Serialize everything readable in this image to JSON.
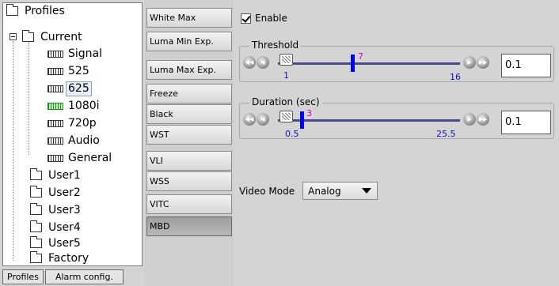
{
  "tree": {
    "root": "Profiles",
    "current": "Current",
    "current_children": [
      "Signal",
      "525",
      "625",
      "1080i",
      "720p",
      "Audio",
      "General"
    ],
    "users": [
      "User1",
      "User2",
      "User3",
      "User4",
      "User5"
    ],
    "factory": "Factory",
    "selected": "625"
  },
  "bottom_tabs": [
    "Profiles",
    "Alarm config."
  ],
  "categories": [
    "White Max",
    "Luma Min Exp.",
    "Luma Max Exp.",
    "Freeze",
    "Black",
    "WST",
    "VLI",
    "WSS",
    "VITC",
    "MBD"
  ],
  "active_category": "MBD",
  "settings": {
    "enable_label": "Enable",
    "enable_checked": true,
    "threshold": {
      "title": "Threshold",
      "min": "1",
      "max": "16",
      "marker": "7",
      "value": "0.1"
    },
    "duration": {
      "title": "Duration (sec)",
      "min": "0.5",
      "max": "25.5",
      "marker": "3",
      "value": "0.1"
    },
    "video_mode_label": "Video Mode",
    "video_mode_value": "Analog"
  },
  "nav_buttons": {
    "fast_back": "◀◀",
    "back": "◀",
    "forward": "▶",
    "fast_forward": "▶▶"
  }
}
